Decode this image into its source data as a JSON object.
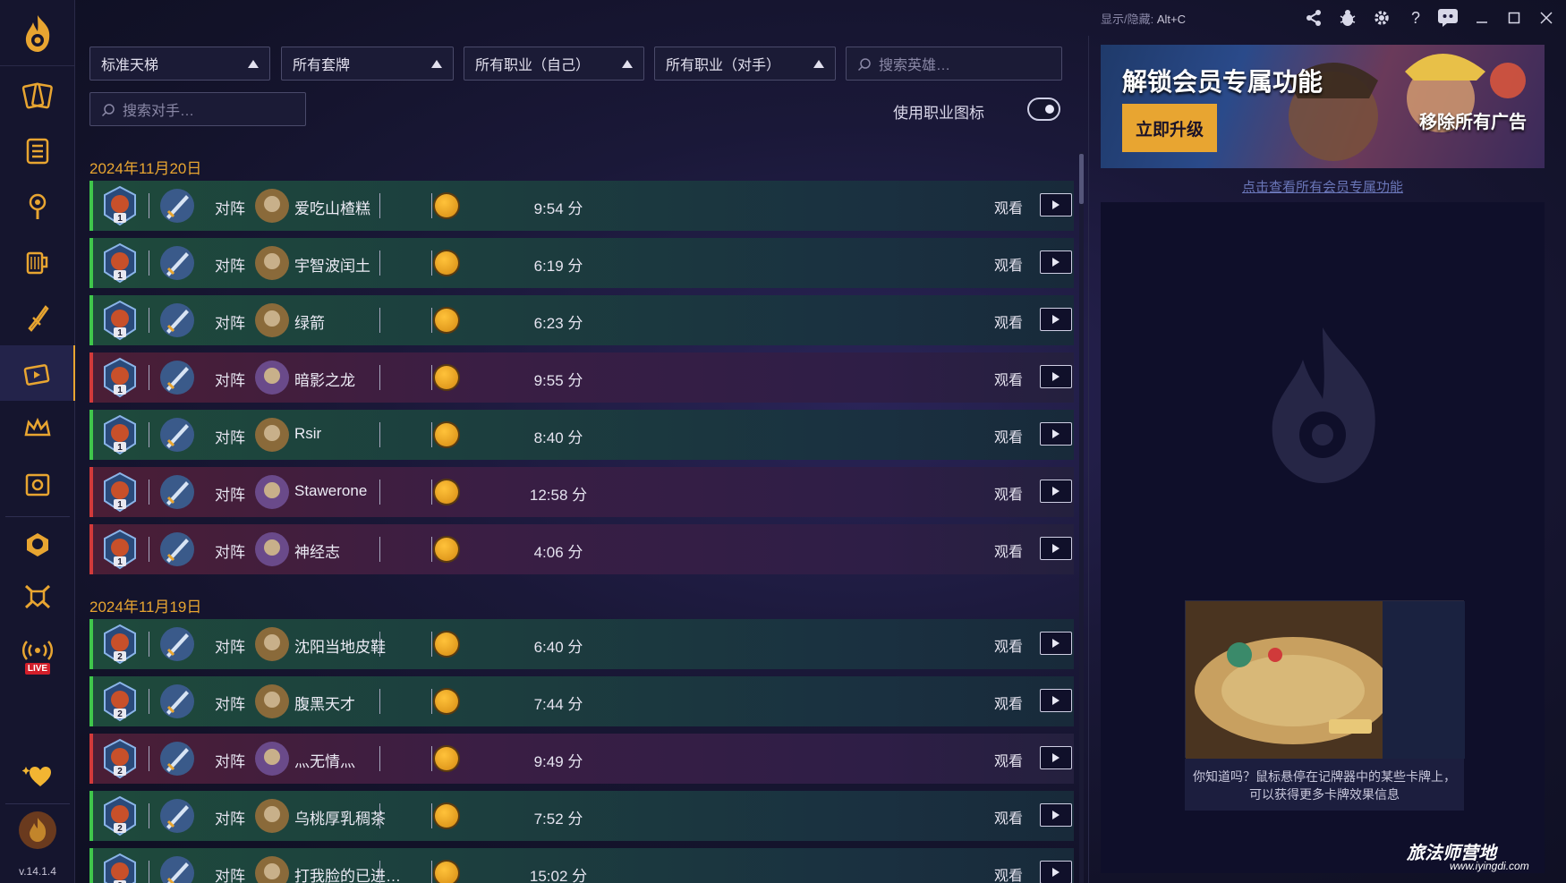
{
  "titlebar": {
    "hint_label": "显示/隐藏:",
    "hint_key": "Alt+C"
  },
  "filters": {
    "mode": "标准天梯",
    "deck": "所有套牌",
    "class_self": "所有职业（自己）",
    "class_opp": "所有职业（对手）",
    "hero_search_placeholder": "搜索英雄…",
    "opp_search_placeholder": "搜索对手…",
    "toggle_label": "使用职业图标"
  },
  "sidebar": {
    "version": "v.14.1.4",
    "live_label": "LIVE"
  },
  "groups": [
    {
      "date": "2024年11月20日",
      "games": [
        {
          "rank": "1",
          "vs": "对阵",
          "opponent": "爱吃山楂糕",
          "duration": "9:54 分",
          "watch": "观看",
          "result": "win"
        },
        {
          "rank": "1",
          "vs": "对阵",
          "opponent": "宇智波闰土",
          "duration": "6:19 分",
          "watch": "观看",
          "result": "win"
        },
        {
          "rank": "1",
          "vs": "对阵",
          "opponent": "绿箭",
          "duration": "6:23 分",
          "watch": "观看",
          "result": "win"
        },
        {
          "rank": "1",
          "vs": "对阵",
          "opponent": "暗影之龙",
          "duration": "9:55 分",
          "watch": "观看",
          "result": "loss"
        },
        {
          "rank": "1",
          "vs": "对阵",
          "opponent": "Rsir",
          "duration": "8:40 分",
          "watch": "观看",
          "result": "win"
        },
        {
          "rank": "1",
          "vs": "对阵",
          "opponent": "Stawerone",
          "duration": "12:58 分",
          "watch": "观看",
          "result": "loss"
        },
        {
          "rank": "1",
          "vs": "对阵",
          "opponent": "神经志",
          "duration": "4:06 分",
          "watch": "观看",
          "result": "loss"
        }
      ]
    },
    {
      "date": "2024年11月19日",
      "games": [
        {
          "rank": "2",
          "vs": "对阵",
          "opponent": "沈阳当地皮鞋",
          "duration": "6:40 分",
          "watch": "观看",
          "result": "win"
        },
        {
          "rank": "2",
          "vs": "对阵",
          "opponent": "腹黑天才",
          "duration": "7:44 分",
          "watch": "观看",
          "result": "win"
        },
        {
          "rank": "2",
          "vs": "对阵",
          "opponent": "灬无情灬",
          "duration": "9:49 分",
          "watch": "观看",
          "result": "loss"
        },
        {
          "rank": "2",
          "vs": "对阵",
          "opponent": "乌桃厚乳稠茶",
          "duration": "7:52 分",
          "watch": "观看",
          "result": "win"
        },
        {
          "rank": "2",
          "vs": "对阵",
          "opponent": "打我脸的已进…",
          "duration": "15:02 分",
          "watch": "观看",
          "result": "win"
        }
      ]
    }
  ],
  "promo": {
    "title": "解锁会员专属功能",
    "button": "立即升级",
    "subtitle": "移除所有广告",
    "link": "点击查看所有会员专属功能"
  },
  "tip": {
    "text": "你知道吗？鼠标悬停在记牌器中的某些卡牌上，可以获得更多卡牌效果信息"
  },
  "watermark": {
    "brand": "旅法师营地",
    "url": "www.iyingdi.com"
  },
  "colors": {
    "accent": "#e8a531",
    "win": "#3fc64b",
    "loss": "#d23a3a"
  }
}
